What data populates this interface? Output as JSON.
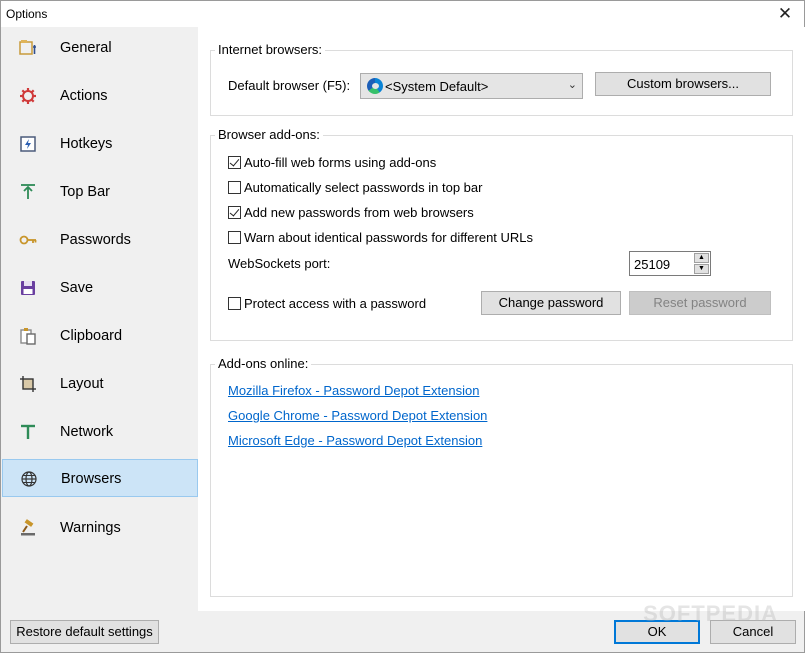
{
  "window": {
    "title": "Options",
    "close": "✕"
  },
  "sidebar": {
    "items": [
      {
        "label": "General",
        "icon": "general-icon"
      },
      {
        "label": "Actions",
        "icon": "gear-icon"
      },
      {
        "label": "Hotkeys",
        "icon": "hotkey-icon"
      },
      {
        "label": "Top Bar",
        "icon": "top-bar-icon"
      },
      {
        "label": "Passwords",
        "icon": "key-icon"
      },
      {
        "label": "Save",
        "icon": "floppy-icon"
      },
      {
        "label": "Clipboard",
        "icon": "clipboard-icon"
      },
      {
        "label": "Layout",
        "icon": "layout-icon"
      },
      {
        "label": "Network",
        "icon": "network-icon"
      },
      {
        "label": "Browsers",
        "icon": "globe-icon",
        "selected": true
      },
      {
        "label": "Warnings",
        "icon": "gavel-icon"
      }
    ]
  },
  "internet_browsers": {
    "title": "Internet browsers:",
    "default_label": "Default browser (F5):",
    "default_value": "<System Default>",
    "custom_button": "Custom browsers..."
  },
  "addons": {
    "title": "Browser add-ons:",
    "checkboxes": [
      {
        "label": "Auto-fill web forms using add-ons",
        "checked": true
      },
      {
        "label": "Automatically select passwords in top bar",
        "checked": false
      },
      {
        "label": "Add new passwords from web browsers",
        "checked": true
      },
      {
        "label": "Warn about identical passwords for different URLs",
        "checked": false
      }
    ],
    "port_label": "WebSockets port:",
    "port_value": "25109",
    "protect_label": "Protect access with a password",
    "protect_checked": false,
    "change_password": "Change password",
    "reset_password": "Reset password"
  },
  "online": {
    "title": "Add-ons online:",
    "links": [
      "Mozilla Firefox - Password Depot Extension",
      "Google Chrome - Password Depot Extension",
      "Microsoft Edge - Password Depot Extension"
    ]
  },
  "footer": {
    "restore": "Restore default settings",
    "ok": "OK",
    "cancel": "Cancel"
  },
  "watermark": "SOFTPEDIA",
  "colors": {
    "accent": "#0078d7",
    "selected_bg": "#cce4f7",
    "link": "#0066cc"
  }
}
